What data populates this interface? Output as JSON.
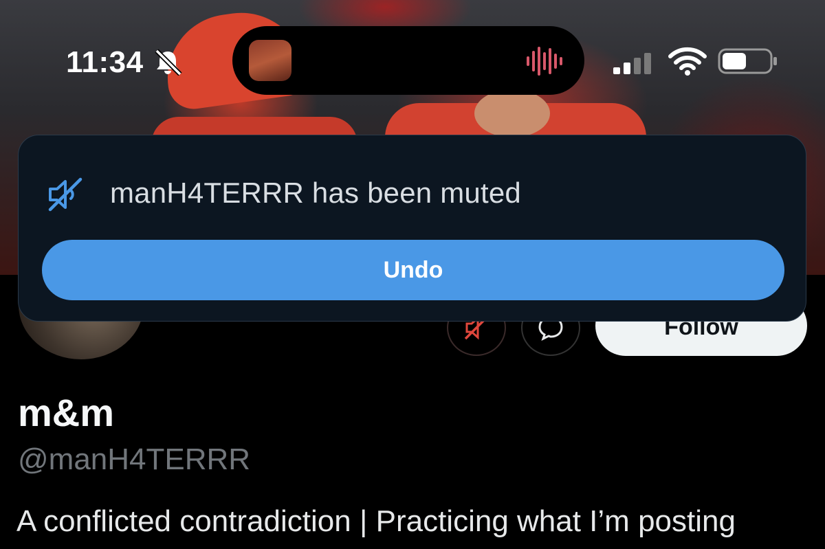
{
  "status_bar": {
    "time": "11:34",
    "icons": [
      "bell-slash-icon",
      "audio-wave-icon",
      "cellular-signal-icon",
      "wifi-icon",
      "battery-icon"
    ]
  },
  "toast": {
    "message": "manH4TERRR has been muted",
    "undo_label": "Undo",
    "icon": "mute-icon",
    "accent_color": "#4a98e6",
    "background_color": "#0c1621"
  },
  "profile": {
    "display_name": "m&m",
    "handle": "@manH4TERRR",
    "bio": "A conflicted contradiction | Practicing what I’m posting",
    "actions": {
      "mute_icon": "unmute-icon",
      "message_icon": "message-icon",
      "follow_label": "Follow"
    },
    "muted_color": "#e0473d"
  }
}
